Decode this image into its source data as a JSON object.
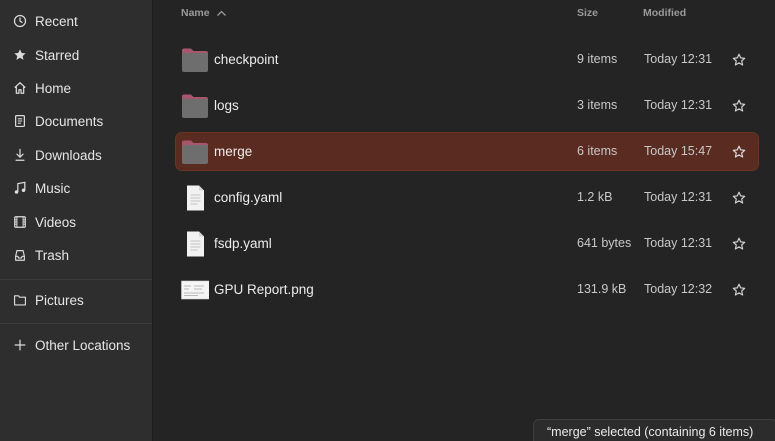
{
  "sidebar": {
    "items": [
      {
        "label": "Recent",
        "icon": "clock-icon"
      },
      {
        "label": "Starred",
        "icon": "star-icon"
      },
      {
        "label": "Home",
        "icon": "home-icon"
      },
      {
        "label": "Documents",
        "icon": "document-icon"
      },
      {
        "label": "Downloads",
        "icon": "download-icon"
      },
      {
        "label": "Music",
        "icon": "music-icon"
      },
      {
        "label": "Videos",
        "icon": "video-icon"
      },
      {
        "label": "Trash",
        "icon": "trash-icon"
      },
      {
        "label": "Pictures",
        "icon": "folder-icon"
      },
      {
        "label": "Other Locations",
        "icon": "plus-icon"
      }
    ]
  },
  "columns": {
    "name": "Name",
    "size": "Size",
    "modified": "Modified"
  },
  "files": [
    {
      "name": "checkpoint",
      "size": "9 items",
      "modified": "Today 12:31",
      "type": "folder"
    },
    {
      "name": "logs",
      "size": "3 items",
      "modified": "Today 12:31",
      "type": "folder"
    },
    {
      "name": "merge",
      "size": "6 items",
      "modified": "Today 15:47",
      "type": "folder",
      "selected": true
    },
    {
      "name": "config.yaml",
      "size": "1.2 kB",
      "modified": "Today 12:31",
      "type": "text"
    },
    {
      "name": "fsdp.yaml",
      "size": "641 bytes",
      "modified": "Today 12:31",
      "type": "text"
    },
    {
      "name": "GPU Report.png",
      "size": "131.9 kB",
      "modified": "Today 12:32",
      "type": "image"
    }
  ],
  "status": {
    "text": "“merge” selected  (containing 6 items)"
  },
  "colors": {
    "selection": "#5a2b20",
    "folder_tab": "#a8566d",
    "folder_body": "#6e6e6e"
  }
}
